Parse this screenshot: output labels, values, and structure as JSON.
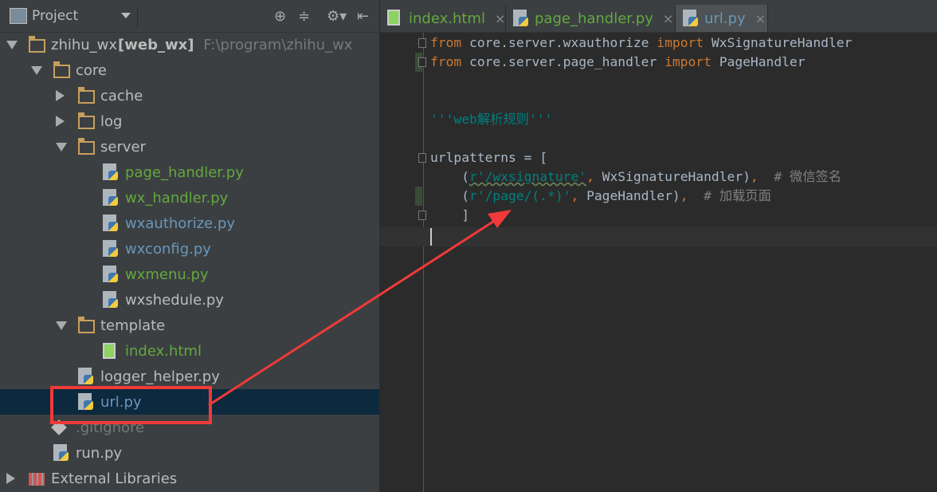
{
  "project_panel": {
    "title": "Project",
    "icons": [
      "locate-icon",
      "collapse-icon",
      "gear-icon",
      "hide-icon"
    ]
  },
  "tree": [
    {
      "label": "zhihu_wx",
      "module": "[web_wx]",
      "path": "F:\\program\\zhihu_wx",
      "type": "folder",
      "expanded": true
    },
    {
      "label": "core",
      "type": "folder",
      "expanded": true
    },
    {
      "label": "cache",
      "type": "folder",
      "expanded": false
    },
    {
      "label": "log",
      "type": "folder",
      "expanded": false
    },
    {
      "label": "server",
      "type": "folder",
      "expanded": true
    },
    {
      "label": "page_handler.py",
      "type": "python",
      "status": "added"
    },
    {
      "label": "wx_handler.py",
      "type": "python",
      "status": "added"
    },
    {
      "label": "wxauthorize.py",
      "type": "python",
      "status": "modified"
    },
    {
      "label": "wxconfig.py",
      "type": "python",
      "status": "modified"
    },
    {
      "label": "wxmenu.py",
      "type": "python",
      "status": "added"
    },
    {
      "label": "wxshedule.py",
      "type": "python",
      "status": "none"
    },
    {
      "label": "template",
      "type": "folder",
      "expanded": true
    },
    {
      "label": "index.html",
      "type": "html",
      "status": "added"
    },
    {
      "label": "logger_helper.py",
      "type": "python",
      "status": "none"
    },
    {
      "label": "url.py",
      "type": "python",
      "status": "modified",
      "selected": true
    },
    {
      "label": ".gitignore",
      "type": "git",
      "status": "ignored"
    },
    {
      "label": "run.py",
      "type": "python",
      "status": "none"
    },
    {
      "label": "External Libraries",
      "type": "library",
      "expanded": false
    }
  ],
  "tabs": [
    {
      "label": "index.html",
      "active": false
    },
    {
      "label": "page_handler.py",
      "active": false
    },
    {
      "label": "url.py",
      "active": true
    }
  ],
  "tab_close": "×",
  "code": {
    "l1": {
      "from": "from",
      "mod": " core.server.wxauthorize ",
      "imp": "import",
      "name": " WxSignatureHandler"
    },
    "l2": {
      "from": "from",
      "mod": " core.server.page_handler ",
      "imp": "import",
      "name": " PageHandler"
    },
    "doc": "'''web解析规则'''",
    "l6": "urlpatterns = [",
    "l7": {
      "open": "    (",
      "str": "r'/wxsignature'",
      "comma": ",",
      "name": " WxSignatureHandler)",
      "comma2": ",",
      "comment": "  # 微信签名"
    },
    "l8": {
      "open": "    (",
      "str": "r'/page/(.*)'",
      "comma": ",",
      "name": " PageHandler)",
      "comma2": ",",
      "comment": "  # 加载页面"
    },
    "l9": "    ]"
  },
  "colors": {
    "annotation": "#f03a3a",
    "selection": "#0d293e"
  }
}
